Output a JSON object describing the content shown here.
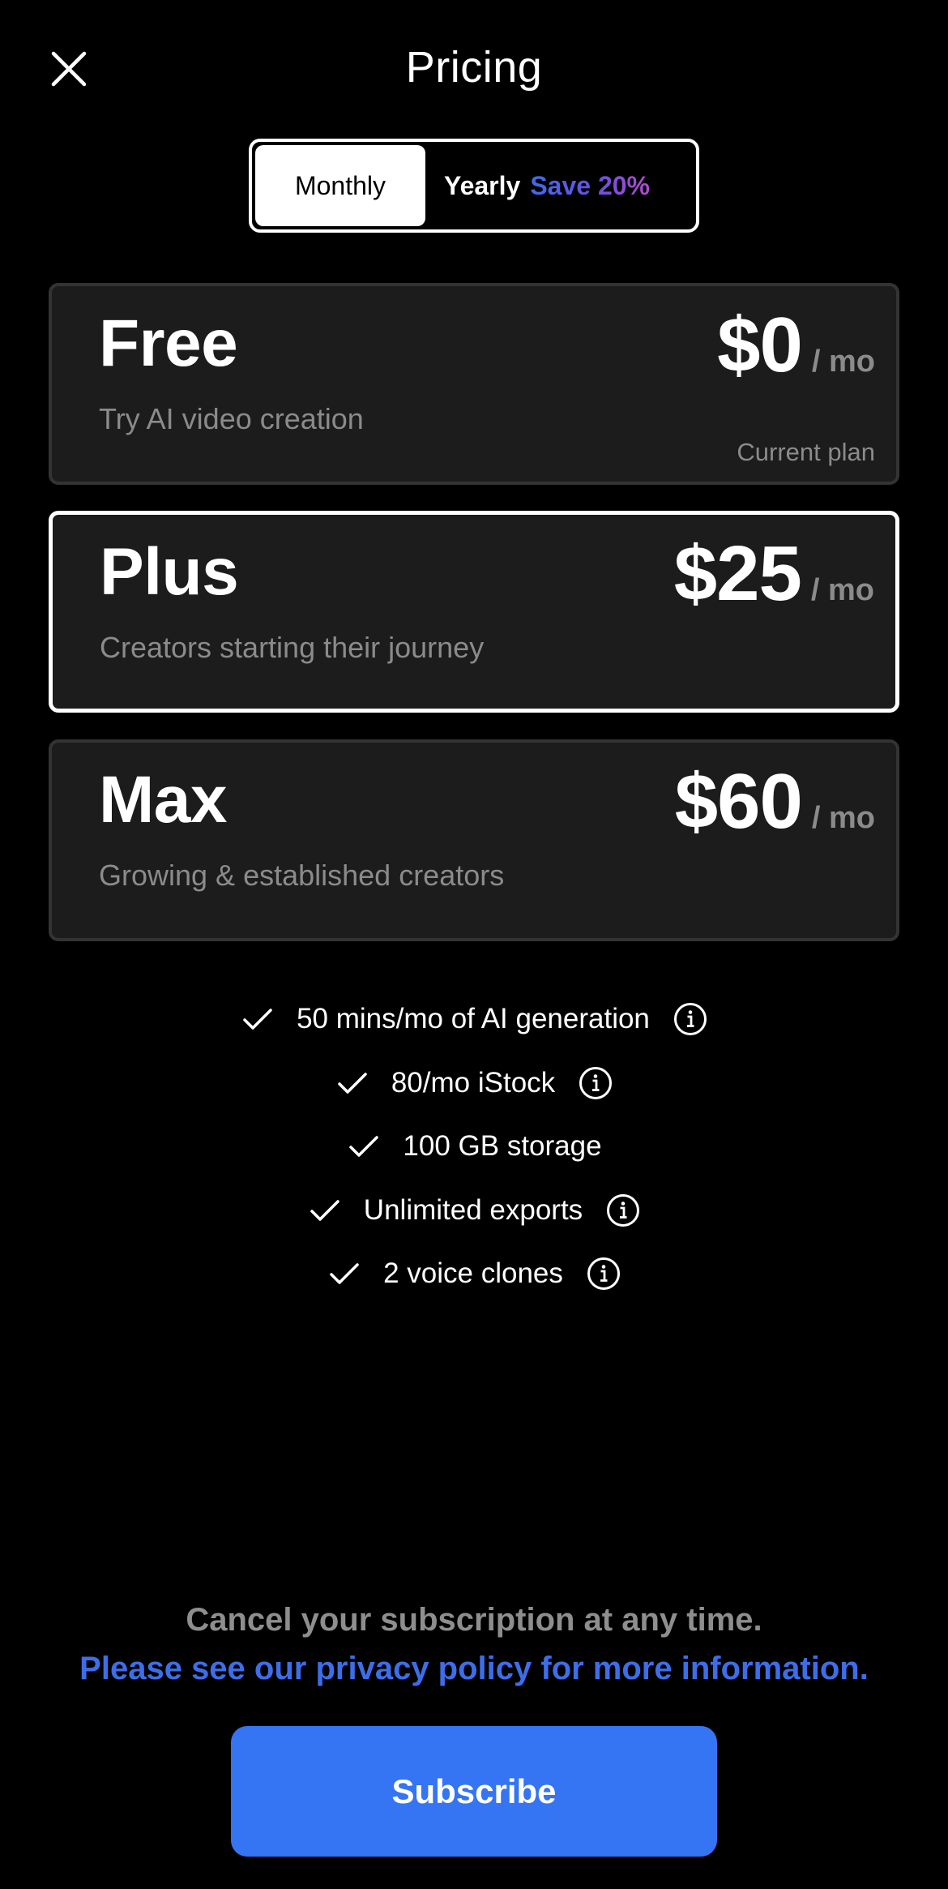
{
  "header": {
    "title": "Pricing",
    "close_icon": "close-icon"
  },
  "billing_toggle": {
    "options": [
      {
        "label": "Monthly",
        "selected": true
      },
      {
        "label": "Yearly",
        "badge": "Save 20%",
        "selected": false
      }
    ]
  },
  "plans": [
    {
      "name": "Free",
      "description": "Try AI video creation",
      "price": "$0",
      "unit": "/ mo",
      "status": "Current plan",
      "selected": false
    },
    {
      "name": "Plus",
      "description": "Creators starting their journey",
      "price": "$25",
      "unit": "/ mo",
      "selected": true
    },
    {
      "name": "Max",
      "description": "Growing & established creators",
      "price": "$60",
      "unit": "/ mo",
      "selected": false
    }
  ],
  "features": [
    {
      "text": "50 mins/mo of AI generation",
      "icon": "check-icon",
      "info": true
    },
    {
      "text": "80/mo iStock",
      "icon": "check-icon",
      "info": true
    },
    {
      "text": "100 GB storage",
      "icon": "check-icon",
      "info": false
    },
    {
      "text": "Unlimited exports",
      "icon": "check-icon",
      "info": true
    },
    {
      "text": "2 voice clones",
      "icon": "check-icon",
      "info": true
    }
  ],
  "footer": {
    "note": "Cancel your subscription at any time.",
    "privacy_link": "Please see our privacy policy for more information."
  },
  "subscribe_button": {
    "label": "Subscribe"
  },
  "colors": {
    "background": "#000000",
    "card": "#1c1c1c",
    "accent_blue": "#3574f2",
    "link_blue": "#3d6ee8",
    "muted_text": "#8b8b8b"
  }
}
